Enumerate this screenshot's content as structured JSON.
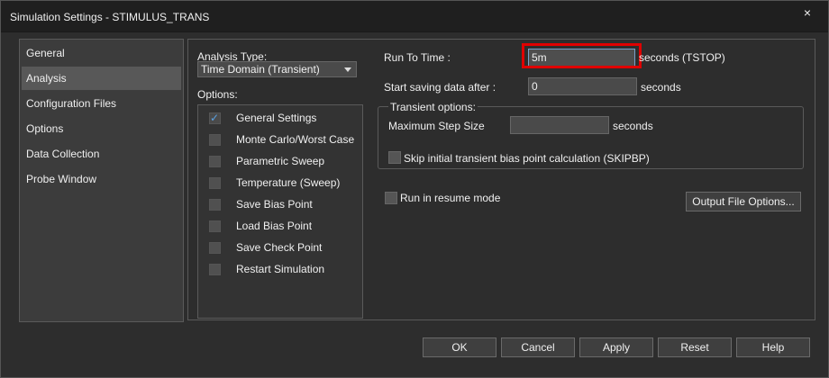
{
  "window": {
    "title": "Simulation Settings - STIMULUS_TRANS",
    "close_glyph": "×"
  },
  "sidebar": {
    "items": [
      {
        "label": "General",
        "active": false
      },
      {
        "label": "Analysis",
        "active": true
      },
      {
        "label": "Configuration Files",
        "active": false
      },
      {
        "label": "Options",
        "active": false
      },
      {
        "label": "Data Collection",
        "active": false
      },
      {
        "label": "Probe Window",
        "active": false
      }
    ]
  },
  "analysis": {
    "type_label": "Analysis Type:",
    "type_value": "Time Domain (Transient)",
    "options_label": "Options:",
    "options": [
      {
        "label": "General Settings",
        "checked": true
      },
      {
        "label": "Monte Carlo/Worst Case",
        "checked": false
      },
      {
        "label": "Parametric Sweep",
        "checked": false
      },
      {
        "label": "Temperature (Sweep)",
        "checked": false
      },
      {
        "label": "Save Bias Point",
        "checked": false
      },
      {
        "label": "Load Bias Point",
        "checked": false
      },
      {
        "label": "Save Check Point",
        "checked": false
      },
      {
        "label": "Restart Simulation",
        "checked": false
      }
    ]
  },
  "settings": {
    "run_to_time_label": "Run To Time :",
    "run_to_time_value": "5m",
    "run_to_time_unit": "seconds (TSTOP)",
    "start_saving_label": "Start saving data after :",
    "start_saving_value": "0",
    "start_saving_unit": "seconds",
    "transient_group_label": "Transient options:",
    "max_step_label": "Maximum Step Size",
    "max_step_value": "",
    "max_step_unit": "seconds",
    "skip_bias_label": "Skip initial transient bias point calculation (SKIPBP)",
    "resume_label": "Run in resume mode",
    "output_file_options_label": "Output File Options..."
  },
  "footer": {
    "ok": "OK",
    "cancel": "Cancel",
    "apply": "Apply",
    "reset": "Reset",
    "help": "Help"
  },
  "colors": {
    "highlight": "#e00000",
    "check_accent": "#5aa0e0"
  }
}
